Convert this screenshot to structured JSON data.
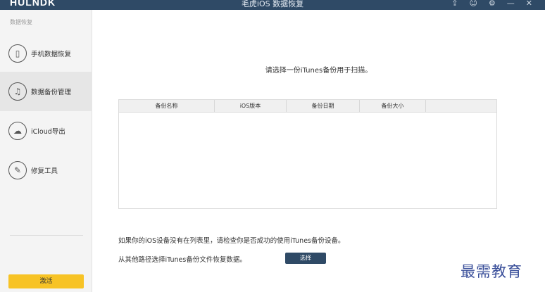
{
  "app": {
    "logo": "HULNDK",
    "window_title": "毛虎iOS 数据恢复",
    "titlebar_icons": [
      "share-icon",
      "user-icon",
      "settings-icon",
      "minimize-icon",
      "close-icon"
    ]
  },
  "sidebar": {
    "section_label": "数据恢复",
    "items": [
      {
        "label": "手机数据恢复",
        "icon": "phone-icon",
        "active": false
      },
      {
        "label": "数据备份管理",
        "icon": "music-note-icon",
        "active": true
      },
      {
        "label": "iCloud导出",
        "icon": "cloud-icon",
        "active": false
      },
      {
        "label": "修复工具",
        "icon": "wrench-icon",
        "active": false
      }
    ],
    "buy_label": "激活"
  },
  "main": {
    "prompt": "请选择一份iTunes备份用于扫描。",
    "table": {
      "columns": [
        "备份名称",
        "iOS版本",
        "备份日期",
        "备份大小"
      ],
      "rows": []
    },
    "note": "如果你的iOS设备没有在列表里，请检查你是否成功的使用iTunes备份设备。",
    "other_path_label": "从其他路径选择iTunes备份文件恢复数据。",
    "select_button": "选择"
  },
  "watermark": "最需教育",
  "colors": {
    "titlebar": "#2f4a66",
    "accent_button": "#2f4a66",
    "buy_button": "#f7c325",
    "sidebar_bg": "#f4f4f4",
    "sidebar_active": "#e6e6e6"
  }
}
